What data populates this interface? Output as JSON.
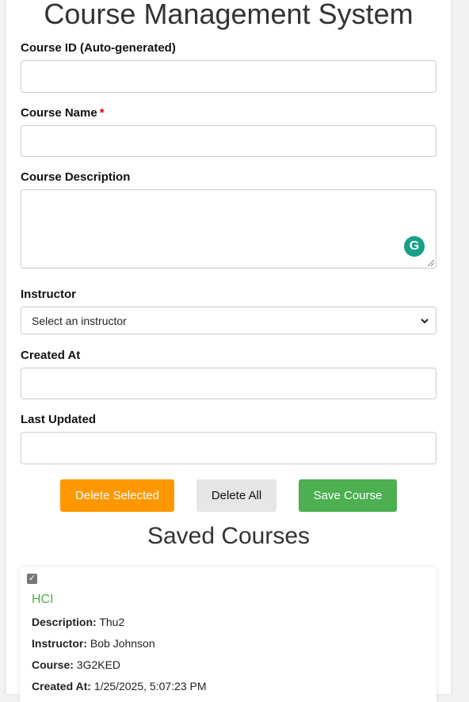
{
  "page": {
    "title": "Course Management System"
  },
  "form": {
    "course_id": {
      "label": "Course ID (Auto-generated)",
      "value": ""
    },
    "course_name": {
      "label": "Course Name",
      "required_mark": "*",
      "value": ""
    },
    "course_description": {
      "label": "Course Description",
      "value": "",
      "assistant_icon": "G"
    },
    "instructor": {
      "label": "Instructor",
      "selected": "Select an instructor",
      "chevron": "⌄"
    },
    "created_at": {
      "label": "Created At",
      "value": ""
    },
    "last_updated": {
      "label": "Last Updated",
      "value": ""
    }
  },
  "actions": {
    "delete_selected": "Delete Selected",
    "delete_all": "Delete All",
    "save_course": "Save Course"
  },
  "saved": {
    "title": "Saved Courses",
    "courses": [
      {
        "checked": true,
        "check_glyph": "✓",
        "name": "HCI",
        "description_label": "Description:",
        "description": "Thu2",
        "instructor_label": "Instructor:",
        "instructor": "Bob Johnson",
        "course_label": "Course:",
        "course": "3G2KED",
        "created_label": "Created At:",
        "created_at": "1/25/2025, 5:07:23 PM"
      }
    ]
  },
  "colors": {
    "orange": "#ff9800",
    "green": "#4caf50",
    "gray": "#e6e6e6",
    "required": "#dd0000",
    "grammarly": "#16a085"
  }
}
